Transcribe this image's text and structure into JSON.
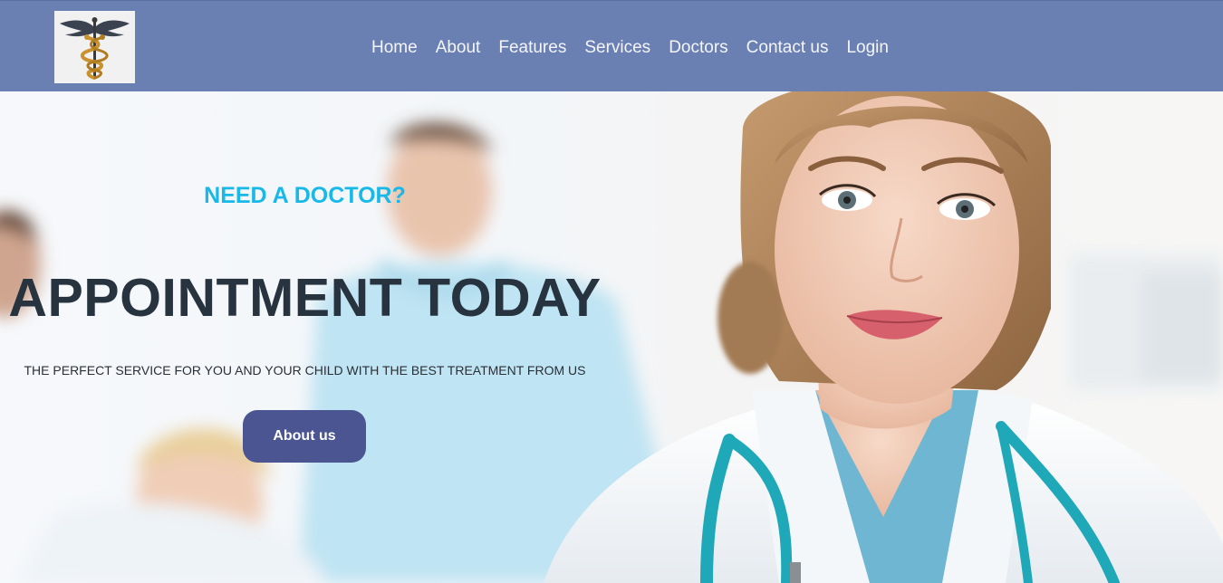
{
  "header": {
    "logo_icon": "caduceus-icon",
    "nav": [
      {
        "label": "Home"
      },
      {
        "label": "About"
      },
      {
        "label": "Features"
      },
      {
        "label": "Services"
      },
      {
        "label": "Doctors"
      },
      {
        "label": "Contact us"
      },
      {
        "label": "Login"
      }
    ]
  },
  "hero": {
    "kicker": "NEED A DOCTOR?",
    "title": "APPOINTMENT TODAY",
    "subtitle": "THE PERFECT SERVICE FOR YOU AND YOUR CHILD WITH THE BEST TREATMENT FROM US",
    "button_label": "About us",
    "image_subject": "smiling female doctor with stethoscope in a clinic, blurred patient and staff in background"
  },
  "colors": {
    "navbar": "#6a80b3",
    "accent_cyan": "#18b8e8",
    "title": "#27343f",
    "button": "#4a5592"
  }
}
